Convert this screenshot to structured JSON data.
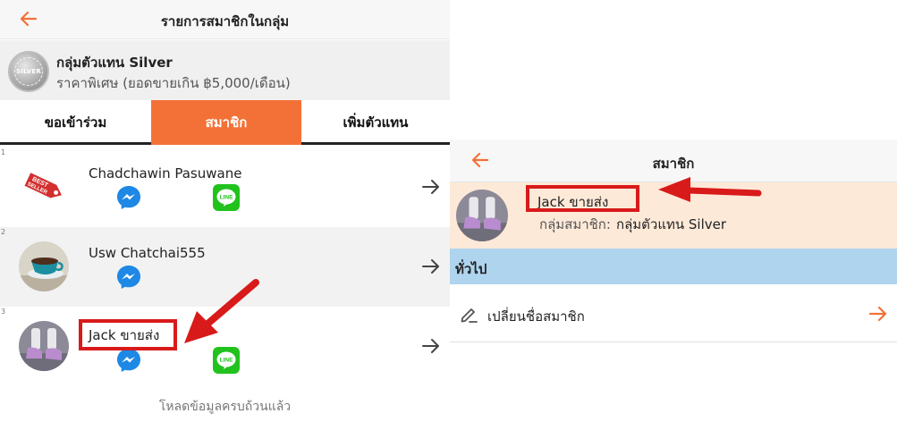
{
  "left_panel": {
    "header": {
      "title": "รายการสมาชิกในกลุ่ม"
    },
    "group": {
      "badge_text": "SILVER",
      "name": "กลุ่มตัวแทน Silver",
      "subtitle": "ราคาพิเศษ (ยอดขายเกิน ฿5,000/เดือน)"
    },
    "tabs": [
      {
        "label": "ขอเข้าร่วม",
        "active": false
      },
      {
        "label": "สมาชิก",
        "active": true
      },
      {
        "label": "เพิ่มตัวแทน",
        "active": false
      }
    ],
    "members": [
      {
        "index": "1",
        "name": "Chadchawin Pasuwane",
        "has_messenger": true,
        "has_line": true,
        "avatar": "best-seller-tag"
      },
      {
        "index": "2",
        "name": "Usw Chatchai555",
        "has_messenger": true,
        "has_line": false,
        "avatar": "coffee-cup"
      },
      {
        "index": "3",
        "name": "Jack ขายส่ง",
        "has_messenger": true,
        "has_line": true,
        "avatar": "sneakers"
      }
    ],
    "footer_note": "โหลดข้อมูลครบถ้วนแล้ว"
  },
  "right_panel": {
    "header": {
      "title": "สมาชิก"
    },
    "member": {
      "name": "Jack ขายส่ง",
      "group_label": "กลุ่มสมาชิก:",
      "group_value": "กลุ่มตัวแทน Silver"
    },
    "section_label": "ทั่วไป",
    "action_label": "เปลี่ยนชื่อสมาชิก"
  },
  "icons": {
    "line_badge": "LINE",
    "back": "arrow-left-icon",
    "forward": "arrow-right-icon",
    "messenger": "messenger-icon",
    "line": "line-app-icon",
    "pencil": "pencil-icon"
  },
  "colors": {
    "accent_orange": "#f37137",
    "messenger_blue": "#1e88e5",
    "line_green": "#21c21d",
    "highlight_red": "#d81a1a",
    "section_blue": "#aed4ee",
    "member_peach": "#fde9d8"
  }
}
